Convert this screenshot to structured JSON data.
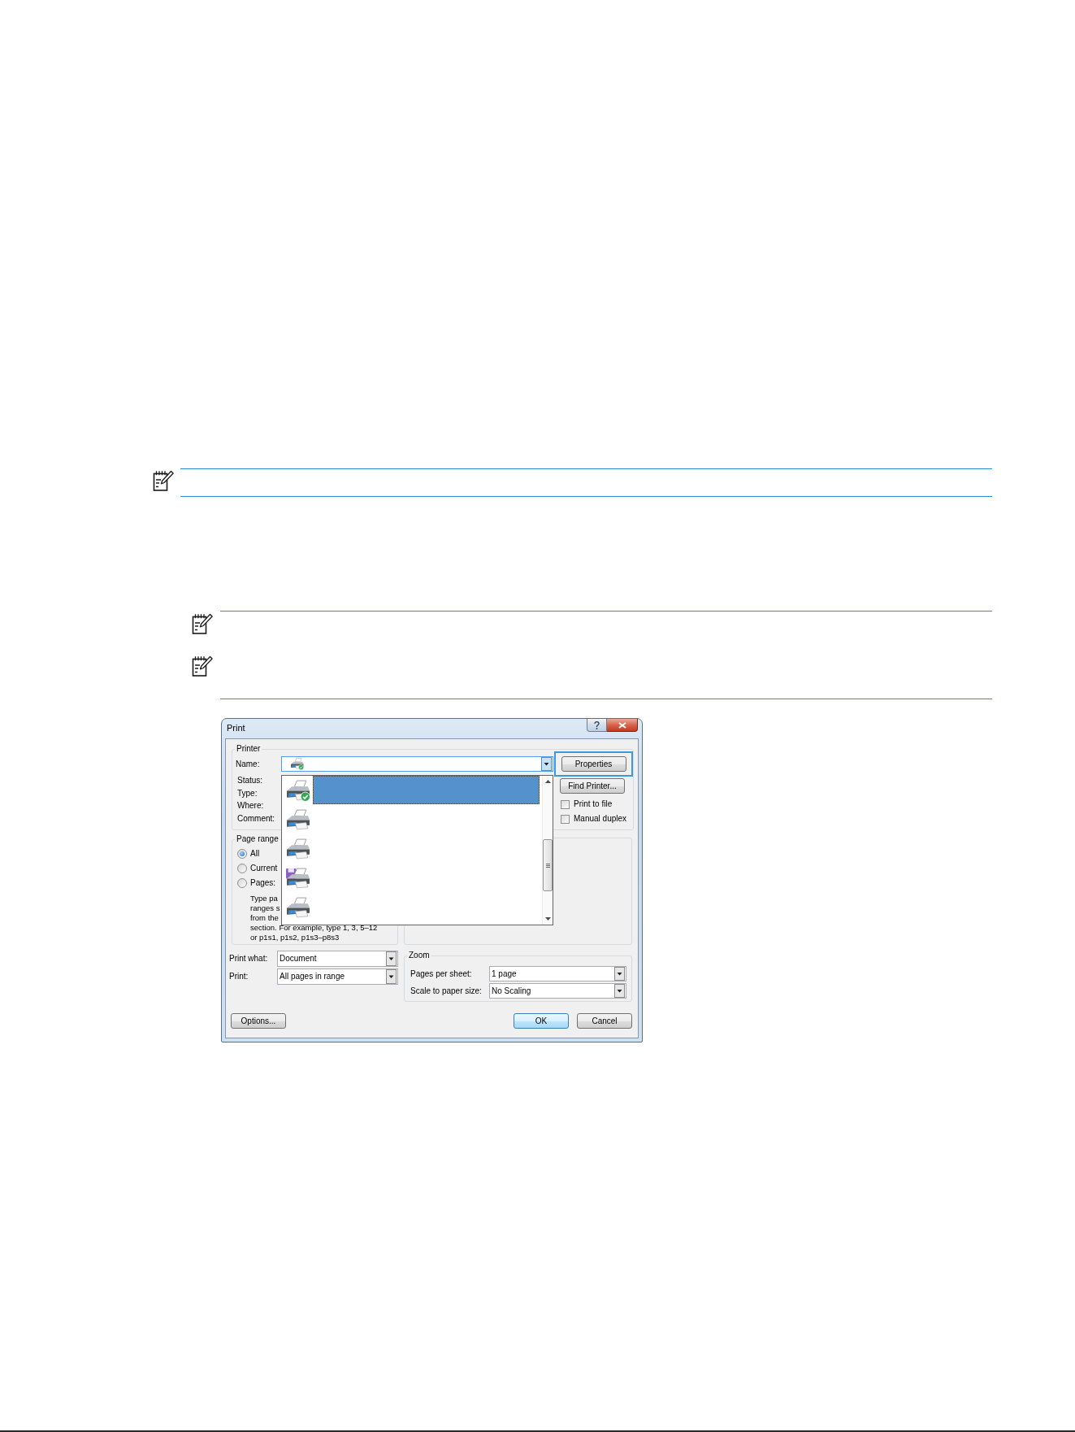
{
  "dialog": {
    "title": "Print",
    "printer": {
      "label": "Printer",
      "name_label": "Name:",
      "expanded": true,
      "info_labels": [
        "Status:",
        "Type:",
        "Where:",
        "Comment:"
      ],
      "buttons": [
        {
          "label": "Properties",
          "highlighted": true
        },
        {
          "label": "Find Printer...",
          "highlighted": false
        }
      ],
      "checkboxes": [
        {
          "label": "Print to file",
          "checked": false
        },
        {
          "label": "Manual duplex",
          "checked": false
        }
      ]
    },
    "printer_list": [
      {
        "kind": "default",
        "selected": true
      },
      {
        "kind": "printer",
        "selected": false
      },
      {
        "kind": "printer",
        "selected": false
      },
      {
        "kind": "file",
        "selected": false
      },
      {
        "kind": "printer",
        "selected": false
      }
    ],
    "page_range": {
      "label": "Page range",
      "options": [
        {
          "label": "All",
          "selected": true
        },
        {
          "label": "Current",
          "selected": false
        },
        {
          "label": "Pages:",
          "selected": false
        }
      ],
      "help_lines": [
        "Type pa",
        "ranges s",
        "from the",
        "section. For example, type 1, 3, 5–12",
        "or p1s1, p1s2, p1s3–p8s3"
      ]
    },
    "print_what": {
      "label": "Print what:",
      "value": "Document"
    },
    "print": {
      "label": "Print:",
      "value": "All pages in range"
    },
    "zoom": {
      "label": "Zoom",
      "fields": [
        {
          "label": "Pages per sheet:",
          "value": "1 page"
        },
        {
          "label": "Scale to paper size:",
          "value": "No Scaling"
        }
      ]
    },
    "buttons": [
      {
        "label": "Options...",
        "default": false
      },
      {
        "label": "OK",
        "default": true
      },
      {
        "label": "Cancel",
        "default": false
      }
    ]
  }
}
